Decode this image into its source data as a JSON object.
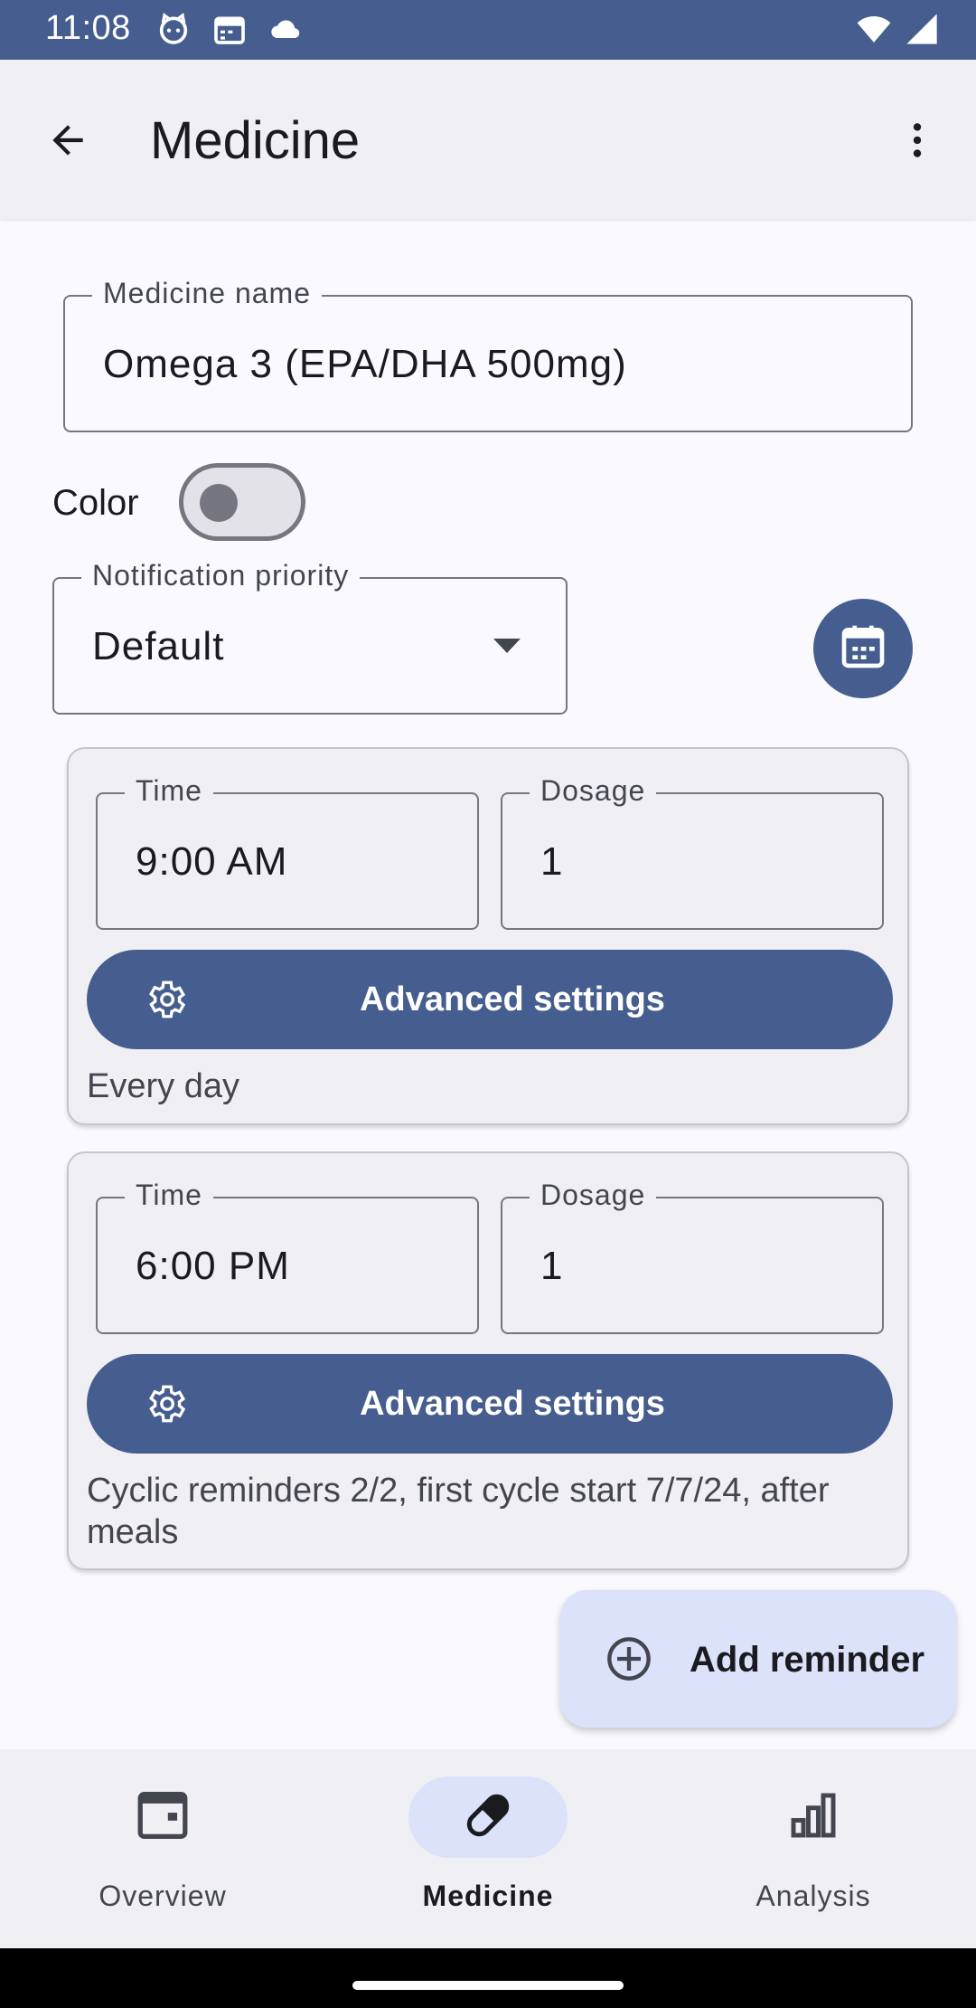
{
  "status_bar": {
    "time": "11:08",
    "icons_left": [
      "cat-face-icon",
      "calendar-status-icon",
      "cloud-icon"
    ],
    "icons_right": [
      "wifi-icon",
      "cellular-signal-icon"
    ]
  },
  "app_bar": {
    "title": "Medicine",
    "back_icon": "arrow-back-icon",
    "menu_icon": "more-vert-icon"
  },
  "form": {
    "medicine_name_label": "Medicine name",
    "medicine_name_value": "Omega 3 (EPA/DHA 500mg)",
    "color_label": "Color",
    "color_toggle_on": false,
    "priority_label": "Notification priority",
    "priority_value": "Default"
  },
  "reminders": [
    {
      "time_label": "Time",
      "time_value": "9:00 AM",
      "dosage_label": "Dosage",
      "dosage_value": "1",
      "advanced_label": "Advanced settings",
      "description": "Every day"
    },
    {
      "time_label": "Time",
      "time_value": "6:00 PM",
      "dosage_label": "Dosage",
      "dosage_value": "1",
      "advanced_label": "Advanced settings",
      "description": "Cyclic reminders 2/2, first cycle start 7/7/24, after meals"
    }
  ],
  "add_reminder": {
    "label": "Add reminder"
  },
  "bottom_nav": {
    "items": [
      {
        "label": "Overview",
        "icon": "calendar-today-icon",
        "active": false
      },
      {
        "label": "Medicine",
        "icon": "pill-icon",
        "active": true
      },
      {
        "label": "Analysis",
        "icon": "bar-chart-icon",
        "active": false
      }
    ]
  },
  "colors": {
    "primary": "#465d8f",
    "surface": "#fafafe",
    "surface_container": "#f0eff4",
    "secondary_container": "#dbe2fa",
    "outline": "#757680"
  }
}
